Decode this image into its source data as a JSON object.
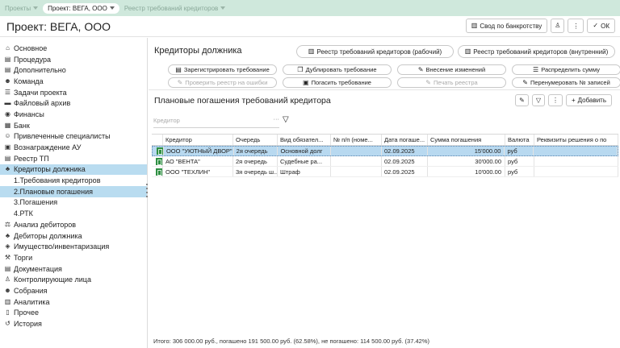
{
  "breadcrumbs": [
    {
      "label": "Проекты",
      "active": false
    },
    {
      "label": "Проект: ВЕГА, ООО",
      "active": true
    },
    {
      "label": "Реестр требований кредиторов",
      "active": false
    }
  ],
  "header": {
    "title": "Проект: ВЕГА, ООО",
    "bankruptcy_label": "Свод по банкротству",
    "ok_label": "ОК",
    "more_label": "⋮"
  },
  "sidebar": {
    "items": [
      {
        "label": "Основное",
        "icon": "home-icon",
        "glyph": "⌂"
      },
      {
        "label": "Процедура",
        "icon": "document-icon",
        "glyph": "▤"
      },
      {
        "label": "Дополнительно",
        "icon": "document-icon",
        "glyph": "▤"
      },
      {
        "label": "Команда",
        "icon": "team-icon",
        "glyph": "☻"
      },
      {
        "label": "Задачи проекта",
        "icon": "tasks-icon",
        "glyph": "☰"
      },
      {
        "label": "Файловый архив",
        "icon": "folder-icon",
        "glyph": "▬"
      },
      {
        "label": "Финансы",
        "icon": "finance-icon",
        "glyph": "◉"
      },
      {
        "label": "Банк",
        "icon": "bank-icon",
        "glyph": "▦"
      },
      {
        "label": "Привлеченные специалисты",
        "icon": "specialists-icon",
        "glyph": "☺"
      },
      {
        "label": "Вознаграждение АУ",
        "icon": "reward-icon",
        "glyph": "▣"
      },
      {
        "label": "Реестр ТП",
        "icon": "register-icon",
        "glyph": "▤"
      },
      {
        "label": "Кредиторы должника",
        "icon": "creditors-icon",
        "glyph": "♣"
      }
    ],
    "sub_items": [
      {
        "label": "1.Требования кредиторов"
      },
      {
        "label": "2.Плановые погашения"
      },
      {
        "label": "3.Погашения"
      },
      {
        "label": "4.РТК"
      }
    ],
    "items_after": [
      {
        "label": "Анализ дебиторов",
        "icon": "analysis-icon",
        "glyph": "⚖"
      },
      {
        "label": "Дебиторы должника",
        "icon": "debtors-icon",
        "glyph": "♣"
      },
      {
        "label": "Имущество/инвентаризация",
        "icon": "property-icon",
        "glyph": "◈"
      },
      {
        "label": "Торги",
        "icon": "auction-icon",
        "glyph": "⚒"
      },
      {
        "label": "Документация",
        "icon": "docs-icon",
        "glyph": "▤"
      },
      {
        "label": "Контролирующие лица",
        "icon": "person-icon",
        "glyph": "♙"
      },
      {
        "label": "Собрания",
        "icon": "meeting-icon",
        "glyph": "☻"
      },
      {
        "label": "Аналитика",
        "icon": "chart-icon",
        "glyph": "▥"
      },
      {
        "label": "Прочее",
        "icon": "other-icon",
        "glyph": "▯"
      },
      {
        "label": "История",
        "icon": "history-icon",
        "glyph": "↺"
      }
    ]
  },
  "main": {
    "section_title": "Кредиторы должника",
    "register_work": "Реестр требований кредиторов (рабочий)",
    "register_internal": "Реестр требований кредиторов (внутренний)",
    "actions": [
      {
        "label": "Зарегистрировать требование",
        "icon": "register-icon",
        "glyph": "▤",
        "disabled": false
      },
      {
        "label": "Дублировать требование",
        "icon": "duplicate-icon",
        "glyph": "❐",
        "disabled": false
      },
      {
        "label": "Внесение изменений",
        "icon": "edit-icon",
        "glyph": "✎",
        "disabled": false
      },
      {
        "label": "Распределить сумму",
        "icon": "distribute-icon",
        "glyph": "☰",
        "disabled": false
      },
      {
        "label": "Проверить реестр на ошибки",
        "icon": "check-icon",
        "glyph": "✎",
        "disabled": true
      },
      {
        "label": "Погасить требование",
        "icon": "repay-icon",
        "glyph": "▣",
        "disabled": false
      },
      {
        "label": "Печать реестра",
        "icon": "print-icon",
        "glyph": "✎",
        "disabled": true
      },
      {
        "label": "Перенумеровать № записей",
        "icon": "renumber-icon",
        "glyph": "✎",
        "disabled": false
      }
    ],
    "sub_title": "Плановые погашения требований кредитора",
    "add_label": "Добавить",
    "filter_placeholder": "Кредитор",
    "filter_more": "···",
    "columns": [
      "",
      "Кредитор",
      "Очередь",
      "Вид обязател...",
      "№ п/п (номе...",
      "Дата погаше...",
      "Сумма погашения",
      "Валюта",
      "Реквизиты решения о по"
    ],
    "rows": [
      {
        "creditor": "ООО \"УЮТНЫЙ ДВОР\"",
        "queue": "2я очередь",
        "kind": "Основной долг",
        "num": "",
        "date": "02.09.2025",
        "amount": "15'000.00",
        "currency": "руб",
        "details": "",
        "selected": true
      },
      {
        "creditor": "АО \"ВЕНТА\"",
        "queue": "2я очередь",
        "kind": "Судебные ра...",
        "num": "",
        "date": "02.09.2025",
        "amount": "30'000.00",
        "currency": "руб",
        "details": "",
        "selected": false
      },
      {
        "creditor": "ООО \"ТЕХЛИН\"",
        "queue": "3я очередь ш...",
        "kind": "Штраф",
        "num": "",
        "date": "02.09.2025",
        "amount": "10'000.00",
        "currency": "руб",
        "details": "",
        "selected": false
      }
    ],
    "footer": "Итого: 306 000.00 руб., погашено 191 500.00 руб. (62.58%), не погашено: 114 500.00 руб. (37.42%)"
  },
  "colors": {
    "topbar": "#cfe8dc",
    "selection": "#b9dcf0",
    "row_mark": "#2f8f43"
  }
}
